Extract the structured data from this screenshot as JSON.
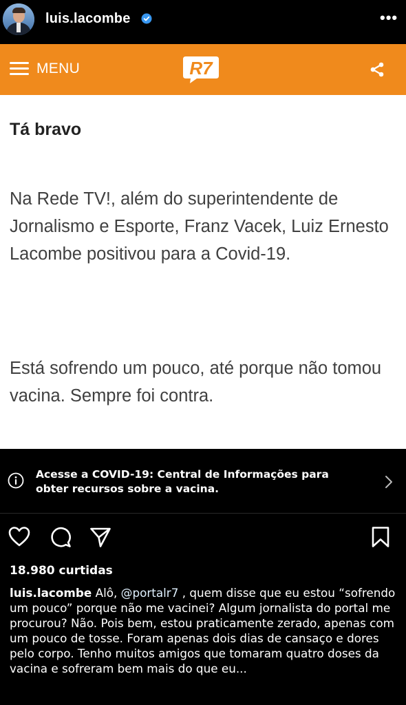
{
  "header": {
    "username": "luis.lacombe",
    "more_label": "•••"
  },
  "r7_bar": {
    "menu_label": "MENU",
    "logo_text": "R7"
  },
  "article": {
    "heading": "Tá bravo",
    "paragraph1": "Na Rede TV!, além do superintendente de Jornalismo e Esporte, Franz Vacek, Luiz Ernesto Lacombe positivou para a Covid-19.",
    "paragraph2": "Está sofrendo um pouco, até porque não tomou vacina. Sempre foi contra."
  },
  "covid_banner": {
    "text": "Acesse a COVID-19: Central de Informações para obter recursos sobre a vacina."
  },
  "post": {
    "likes": "18.980 curtidas",
    "caption_user": "luis.lacombe",
    "caption_intro": " Alô, ",
    "caption_mention": "@portalr7",
    "caption_body": " , quem disse que eu estou “sofrendo um pouco” porque não me vacinei? Algum jornalista do portal me procurou? Não. Pois bem, estou praticamente zerado, apenas com um pouco de tosse. Foram apenas dois dias de cansaço e dores pelo corpo. Tenho muitos amigos que tomaram quatro doses da vacina e sofreram bem mais do que eu..."
  },
  "colors": {
    "r7_orange": "#f08a1c",
    "verified_blue": "#3897f0",
    "article_text": "#404040"
  },
  "icons": [
    "verified-icon",
    "more-icon",
    "menu-icon",
    "share-icon",
    "info-icon",
    "chevron-right-icon",
    "heart-icon",
    "comment-icon",
    "send-icon",
    "bookmark-icon"
  ]
}
